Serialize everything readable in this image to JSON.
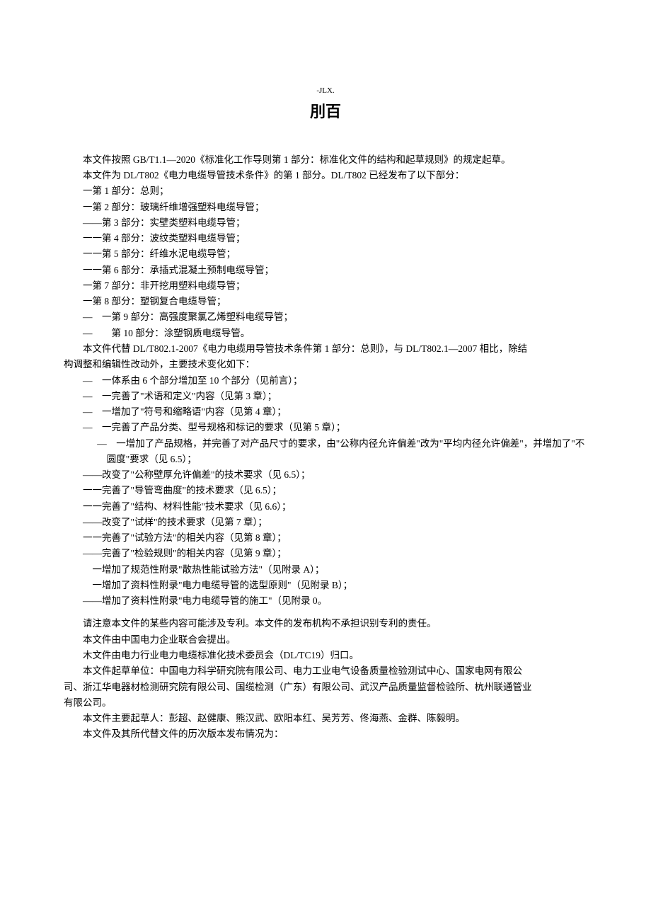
{
  "header_small": "-JLX.",
  "title": "刖百",
  "p1": "本文件按照 GB/T1.1—2020《标准化工作导则第 1 部分：标准化文件的结构和起草规则》的规定起草。",
  "p2": "本文件为 DL/T802《电力电缆导管技术条件》的第 1 部分。DL/T802 已经发布了以下部分：",
  "parts": [
    " 一第 1 部分：总则；",
    "一第 2 部分：玻璃纤维增强塑料电缆导管；",
    "——第 3 部分：实壁类塑料电缆导管；",
    "一一第 4 部分：波纹类塑料电缆导管；",
    "一一第 5 部分：纤维水泥电缆导管；",
    "一一第 6 部分：承插式混凝土预制电缆导管；",
    "一第 7 部分：非开挖用塑料电缆导管；",
    "一第 8 部分：塑钢复合电缆导管；",
    "—　一第 9 部分：高强度聚氯乙烯塑料电缆导管；",
    "—　　第 10 部分：涂塑钢质电缆导管。"
  ],
  "p3a": "本文件代替 DL/T802.1-2007《电力电缆用导管技术条件第 1 部分：总则》，与 DL/T802.1—2007 相比，除结",
  "p3b": "构调整和编辑性改动外，主要技术变化如下：",
  "changes": [
    "—　一体系由 6 个部分增加至 10 个部分（见前言）；",
    "—　一完善了\"术语和定义\"内容（见第 3 章）；",
    "—　一增加了\"符号和缩略语\"内容（见第 4 章）；",
    "—　一完善了产品分类、型号规格和标记的要求（见第 5 章）；",
    "—　一增加了产品规格，并完善了对产品尺寸的要求，由\"公称内径允许偏差\"改为\"平均内径允许偏差\"，并增加了\"不圆度\"要求（见 6.5）；",
    "——改变了\"公称壁厚允许偏差\"的技术要求（见 6.5）；",
    "一一完善了\"导管弯曲度\"的技术要求（见 6.5）；",
    "一一完善了\"结构、材料性能\"技术要求（见 6.6）；",
    "——改变了\"试样\"的技术要求（见第 7 章）；",
    "一一完善了\"试验方法\"的相关内容（见第 8 章）；",
    "——完善了\"检验规则\"的相关内容（见第 9 章）；",
    "　一增加了规范性附录\"散热性能试验方法\"（见附录 A）；",
    "　一增加了资料性附录\"电力电缆导管的选型原则\"（见附录 B）；",
    "——增加了资料性附录\"电力电缆导管的施工\"（见附录 0。"
  ],
  "p4": "请注意本文件的某些内容可能涉及专利。本文件的发布机构不承担识别专利的责任。",
  "p5": "本文件由中国电力企业联合会提出。",
  "p6": "木文件由电力行业电力电缆标准化技术委员会（DL/TC19）归口。",
  "p7a": "本文件起草单位：中国电力科学研究院有限公司、电力工业电气设备质量检验测试中心、国家电网有限公",
  "p7b": "司、浙江华电器材检测研究院有限公司、国缆检测（广东）有限公司、武汉产品质量监督检验所、杭州联通管业",
  "p7c": "有限公司。",
  "p8": "本文件主要起草人：彭超、赵健康、熊汉武、欧阳本红、吴芳芳、佟海燕、金群、陈毅明。",
  "p9": "本文件及其所代替文件的历次版本发布情况为："
}
